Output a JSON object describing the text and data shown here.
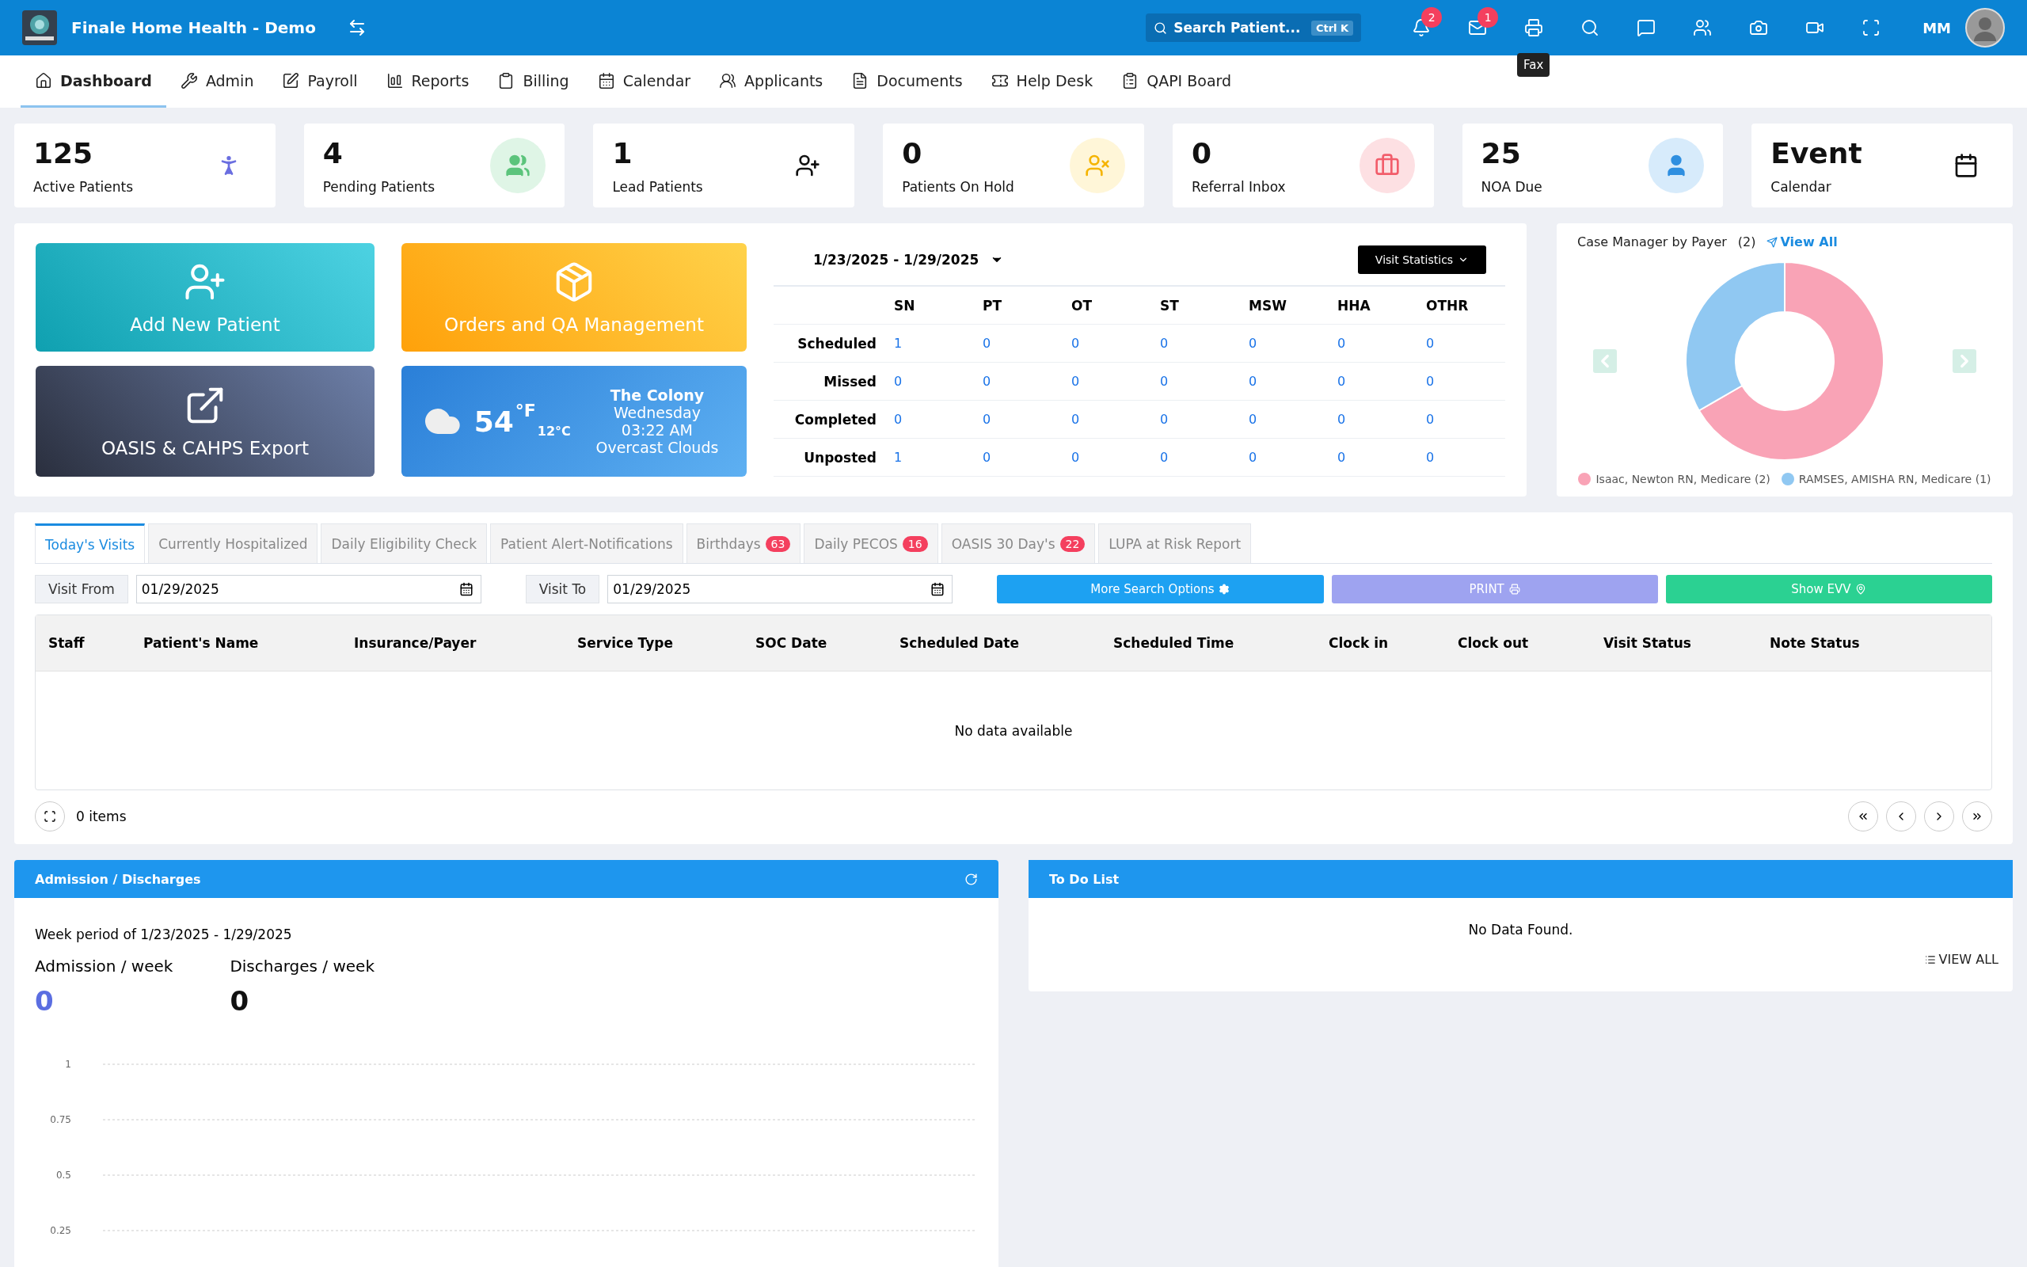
{
  "topbar": {
    "title": "Finale Home Health - Demo",
    "search": {
      "label": "Search Patient...",
      "shortcut": "Ctrl K"
    },
    "bell_badge": "2",
    "mail_badge": "1",
    "print_tooltip": "Fax",
    "user": "MM"
  },
  "nav": [
    {
      "label": "Dashboard",
      "selected": true
    },
    {
      "label": "Admin",
      "selected": false
    },
    {
      "label": "Payroll",
      "selected": false
    },
    {
      "label": "Reports",
      "selected": false
    },
    {
      "label": "Billing",
      "selected": false
    },
    {
      "label": "Calendar",
      "selected": false
    },
    {
      "label": "Applicants",
      "selected": false
    },
    {
      "label": "Documents",
      "selected": false
    },
    {
      "label": "Help Desk",
      "selected": false
    },
    {
      "label": "QAPI Board",
      "selected": false
    }
  ],
  "stats": [
    {
      "value": "125",
      "label": "Active Patients"
    },
    {
      "value": "4",
      "label": "Pending Patients"
    },
    {
      "value": "1",
      "label": "Lead Patients"
    },
    {
      "value": "0",
      "label": "Patients On Hold"
    },
    {
      "value": "0",
      "label": "Referral Inbox"
    },
    {
      "value": "25",
      "label": "NOA Due"
    },
    {
      "value": "Event",
      "label": "Calendar"
    }
  ],
  "tiles": [
    {
      "kind": "action",
      "label": "Add New Patient"
    },
    {
      "kind": "action",
      "label": "Orders and QA Management"
    },
    {
      "kind": "action",
      "label": "OASIS & CAHPS Export"
    },
    {
      "kind": "weather",
      "temp": "54",
      "unit": "°F",
      "alt": "12°C",
      "city": "The Colony",
      "time": "Wednesday 03:22 AM",
      "condition": "Overcast Clouds"
    }
  ],
  "visit_stats": {
    "range": "1/23/2025 - 1/29/2025",
    "button": "Visit Statistics",
    "columns": [
      "SN",
      "PT",
      "OT",
      "ST",
      "MSW",
      "HHA",
      "OTHR"
    ],
    "rows": [
      {
        "label": "Scheduled",
        "values": [
          "1",
          "0",
          "0",
          "0",
          "0",
          "0",
          "0"
        ]
      },
      {
        "label": "Missed",
        "values": [
          "0",
          "0",
          "0",
          "0",
          "0",
          "0",
          "0"
        ]
      },
      {
        "label": "Completed",
        "values": [
          "0",
          "0",
          "0",
          "0",
          "0",
          "0",
          "0"
        ]
      },
      {
        "label": "Unposted",
        "values": [
          "1",
          "0",
          "0",
          "0",
          "0",
          "0",
          "0"
        ]
      }
    ]
  },
  "case_manager": {
    "title": "Case Manager by Payer",
    "count": "(2)",
    "link": "View All",
    "legend": [
      {
        "color": "#f9a3b6"
      },
      {
        "color": "#90c8f2"
      }
    ],
    "chart_data": {
      "type": "donut",
      "categories": [
        "Isaac, Newton RN, Medicare (2)",
        "RAMSES, AMISHA RN, Medicare (1)"
      ],
      "values": [
        2,
        1
      ]
    }
  },
  "visits": {
    "tabs": [
      {
        "label": "Today's Visits",
        "selected": true
      },
      {
        "label": "Currently Hospitalized",
        "selected": false
      },
      {
        "label": "Daily Eligibility Check",
        "selected": false
      },
      {
        "label": "Patient Alert-Notifications",
        "selected": false
      },
      {
        "label": "Birthdays",
        "badge": "63",
        "selected": false
      },
      {
        "label": "Daily PECOS",
        "badge": "16",
        "selected": false
      },
      {
        "label": "OASIS 30 Day's",
        "badge": "22",
        "selected": false
      },
      {
        "label": "LUPA at Risk Report",
        "selected": false
      }
    ],
    "from": {
      "label": "Visit From",
      "value": "01/29/2025"
    },
    "to": {
      "label": "Visit To",
      "value": "01/29/2025"
    },
    "buttons": [
      {
        "kind": "search",
        "label": "More Search Options"
      },
      {
        "kind": "print",
        "label": "PRINT"
      },
      {
        "kind": "evv",
        "label": "Show EVV"
      }
    ],
    "columns": [
      "Staff",
      "Patient's Name",
      "Insurance/Payer",
      "Service Type",
      "SOC Date",
      "Scheduled Date",
      "Scheduled Time",
      "Clock in",
      "Clock out",
      "Visit Status",
      "Note Status"
    ],
    "empty": "No data available",
    "count": "0 items"
  },
  "admissions": {
    "title": "Admission / Discharges",
    "period": "Week period of 1/23/2025 - 1/29/2025",
    "metrics": [
      {
        "label": "Admission / week",
        "value": "0",
        "color": "#5b6ee1"
      },
      {
        "label": "Discharges / week",
        "value": "0",
        "color": "#111111"
      }
    ],
    "axis_labels": [
      "1",
      "0.75",
      "0.5",
      "0.25"
    ]
  },
  "todo": {
    "title": "To Do List",
    "empty": "No Data Found.",
    "link": "VIEW ALL"
  }
}
